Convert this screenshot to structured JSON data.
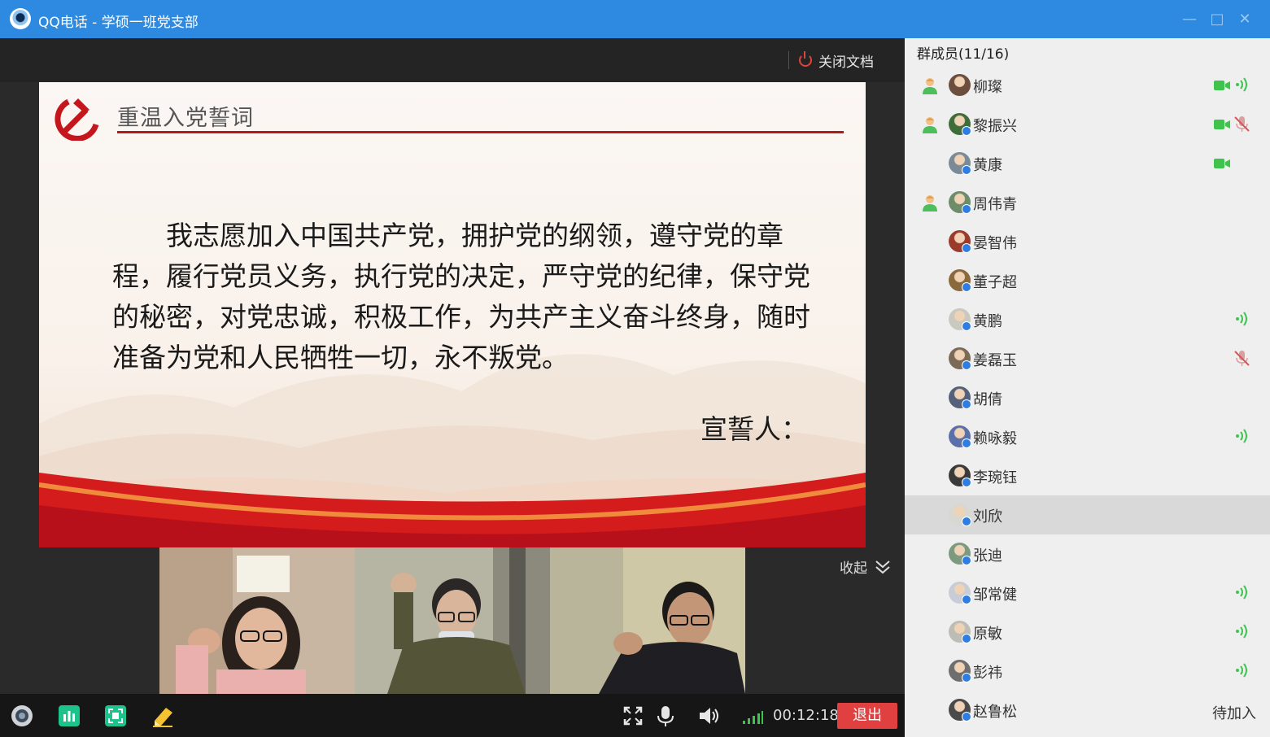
{
  "window": {
    "title": "QQ电话 - 学硕一班党支部",
    "icon": "qq-phone-icon"
  },
  "toolbar_top": {
    "close_doc_label": "关闭文档",
    "close_doc_icon": "power-icon"
  },
  "slide": {
    "title": "重温入党誓词",
    "pledge": "我志愿加入中国共产党，拥护党的纲领，遵守党的章程，履行党员义务，执行党的决定，严守党的纪律，保守党的秘密，对党忠诚，积极工作，为共产主义奋斗终身，随时准备为党和人民牺牲一切，永不叛党。",
    "oath_taker": "宣誓人：",
    "emblem_icon": "party-emblem-icon",
    "accent_color": "#b11a1a"
  },
  "video_strip": {
    "collapse_label": "收起",
    "feeds": [
      "video-feed-1",
      "video-feed-2",
      "video-feed-3"
    ]
  },
  "bottombar": {
    "timer": "00:12:18",
    "exit_label": "退出",
    "exit_color": "#e04040",
    "icons": [
      "camera-icon",
      "chart-icon",
      "screen-share-icon",
      "whiteboard-icon",
      "fullscreen-icon",
      "microphone-icon",
      "speaker-icon",
      "signal-icon"
    ]
  },
  "sidebar": {
    "header": "群成员(11/16)",
    "members": [
      {
        "name": "柳璨",
        "host": true,
        "camera": true,
        "status": "speaking"
      },
      {
        "name": "黎振兴",
        "host": true,
        "camera": true,
        "status": "muted"
      },
      {
        "name": "黄康",
        "host": false,
        "camera": true,
        "status": ""
      },
      {
        "name": "周伟青",
        "host": true,
        "camera": false,
        "status": ""
      },
      {
        "name": "晏智伟",
        "host": false,
        "camera": false,
        "status": ""
      },
      {
        "name": "董子超",
        "host": false,
        "camera": false,
        "status": ""
      },
      {
        "name": "黄鹏",
        "host": false,
        "camera": false,
        "status": "speaking"
      },
      {
        "name": "姜磊玉",
        "host": false,
        "camera": false,
        "status": "muted"
      },
      {
        "name": "胡倩",
        "host": false,
        "camera": false,
        "status": ""
      },
      {
        "name": "赖咏毅",
        "host": false,
        "camera": false,
        "status": "speaking"
      },
      {
        "name": "李琬钰",
        "host": false,
        "camera": false,
        "status": ""
      },
      {
        "name": "刘欣",
        "host": false,
        "camera": false,
        "status": "",
        "selected": true
      },
      {
        "name": "张迪",
        "host": false,
        "camera": false,
        "status": ""
      },
      {
        "name": "邹常健",
        "host": false,
        "camera": false,
        "status": "speaking"
      },
      {
        "name": "原敏",
        "host": false,
        "camera": false,
        "status": "speaking"
      },
      {
        "name": "彭祎",
        "host": false,
        "camera": false,
        "status": "speaking"
      },
      {
        "name": "赵鲁松",
        "host": false,
        "camera": false,
        "status": "pending",
        "pending_label": "待加入"
      }
    ]
  }
}
